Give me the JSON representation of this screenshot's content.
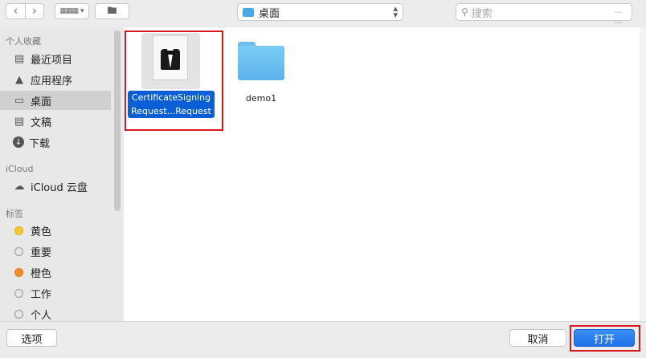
{
  "toolbar": {
    "back_icon": "chevron-left-icon",
    "forward_icon": "chevron-right-icon",
    "view_icon": "grid-view-icon",
    "new_folder_icon": "new-folder-icon",
    "location": "桌面",
    "search_placeholder": "搜索"
  },
  "sidebar": {
    "favorites_header": "个人收藏",
    "favorites": [
      {
        "label": "最近项目",
        "icon": "recents-icon"
      },
      {
        "label": "应用程序",
        "icon": "applications-icon"
      },
      {
        "label": "桌面",
        "icon": "desktop-icon",
        "selected": true
      },
      {
        "label": "文稿",
        "icon": "documents-icon"
      },
      {
        "label": "下载",
        "icon": "downloads-icon"
      }
    ],
    "icloud_header": "iCloud",
    "icloud": [
      {
        "label": "iCloud 云盘",
        "icon": "cloud-icon"
      }
    ],
    "tags_header": "标签",
    "tags": [
      {
        "label": "黄色",
        "color": "#f5c731"
      },
      {
        "label": "重要",
        "color": "#e2e2e2"
      },
      {
        "label": "橙色",
        "color": "#f28f2c"
      },
      {
        "label": "工作",
        "color": "#e2e2e2"
      },
      {
        "label": "个人",
        "color": "#e2e2e2"
      }
    ]
  },
  "files": [
    {
      "name_line1": "CertificateSigning",
      "name_line2": "Request...Request",
      "icon": "certificate-request-icon",
      "selected": true
    },
    {
      "name": "demo1",
      "icon": "folder-icon"
    }
  ],
  "footer": {
    "options_label": "选项",
    "cancel_label": "取消",
    "open_label": "打开"
  },
  "colors": {
    "selection": "#0b5fd6",
    "highlight_border": "#d7191f",
    "primary_button": "#1f70ea"
  }
}
